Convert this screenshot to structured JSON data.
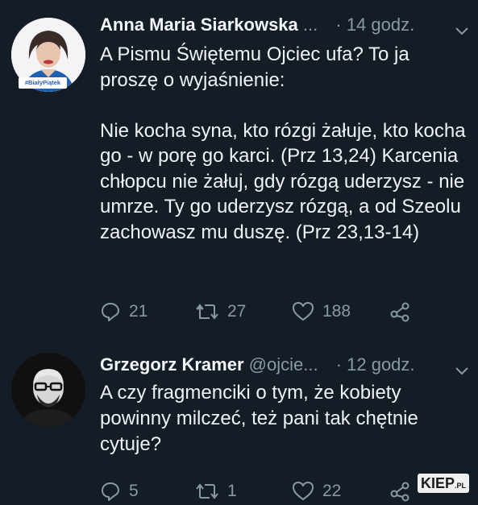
{
  "tweets": [
    {
      "name": "Anna Maria Siarkowska",
      "ellipsis": "...",
      "time": "· 14 godz.",
      "avatar_badge": "#BiałyPiątek",
      "paragraphs": [
        "A Pismu Świętemu Ojciec ufa? To ja proszę o wyjaśnienie:",
        "Nie kocha syna, kto rózgi żałuje, kto kocha go - w porę go karci. (Prz 13,24) Karcenia chłopcu nie żałuj, gdy rózgą uderzysz - nie umrze. Ty go uderzysz rózgą, a od Szeolu zachowasz mu duszę. (Prz 23,13-14)"
      ],
      "replies": "21",
      "retweets": "27",
      "likes": "188"
    },
    {
      "name": "Grzegorz Kramer",
      "handle": "@ojcie...",
      "time": "· 12 godz.",
      "paragraphs": [
        "A czy fragmenciki o tym, że kobiety powinny milczeć, też pani tak chętnie cytuje?"
      ],
      "replies": "5",
      "retweets": "1",
      "likes": "22"
    }
  ],
  "watermark": {
    "main": "KIEP",
    "suffix": ".PL"
  }
}
